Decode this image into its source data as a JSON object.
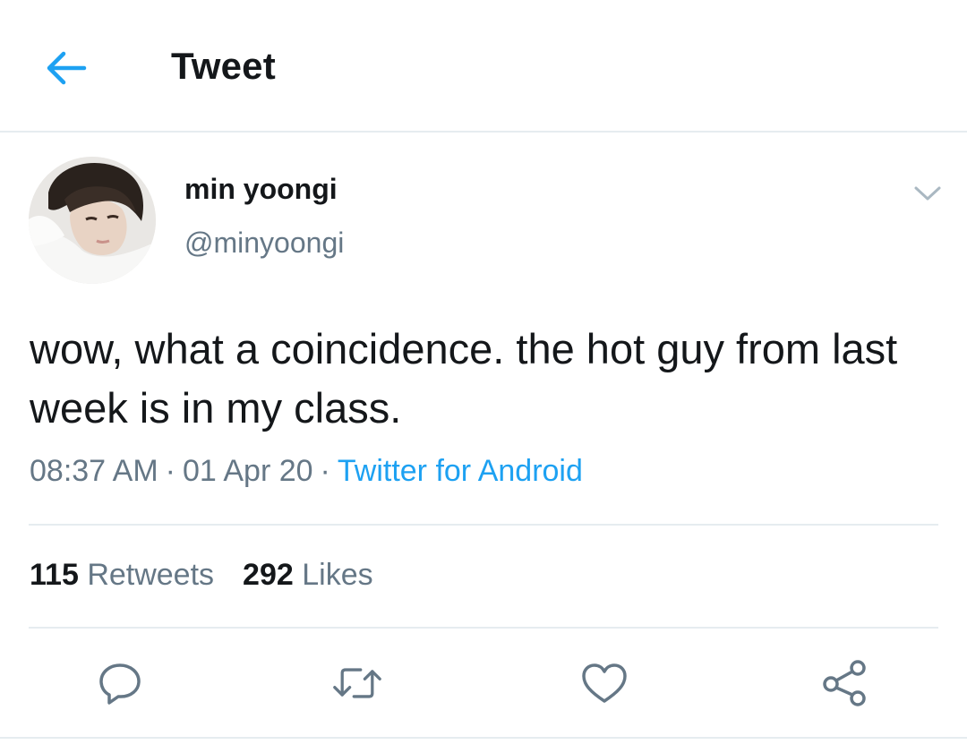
{
  "header": {
    "title": "Tweet",
    "back_icon": "arrow-left-icon",
    "accent_color": "#1da1f2"
  },
  "author": {
    "display_name": "min yoongi",
    "handle": "@minyoongi",
    "avatar_icon": "profile-photo",
    "menu_icon": "chevron-down-icon"
  },
  "tweet": {
    "text": "wow, what a coincidence. the hot guy from last week is in my class.",
    "time": "08:37 AM",
    "date": "01 Apr 20",
    "source": "Twitter for Android",
    "separator": "·"
  },
  "stats": {
    "retweets_count": "115",
    "retweets_label": "Retweets",
    "likes_count": "292",
    "likes_label": "Likes"
  },
  "actions": [
    {
      "icon": "reply-icon"
    },
    {
      "icon": "retweet-icon"
    },
    {
      "icon": "like-icon"
    },
    {
      "icon": "share-icon"
    }
  ]
}
